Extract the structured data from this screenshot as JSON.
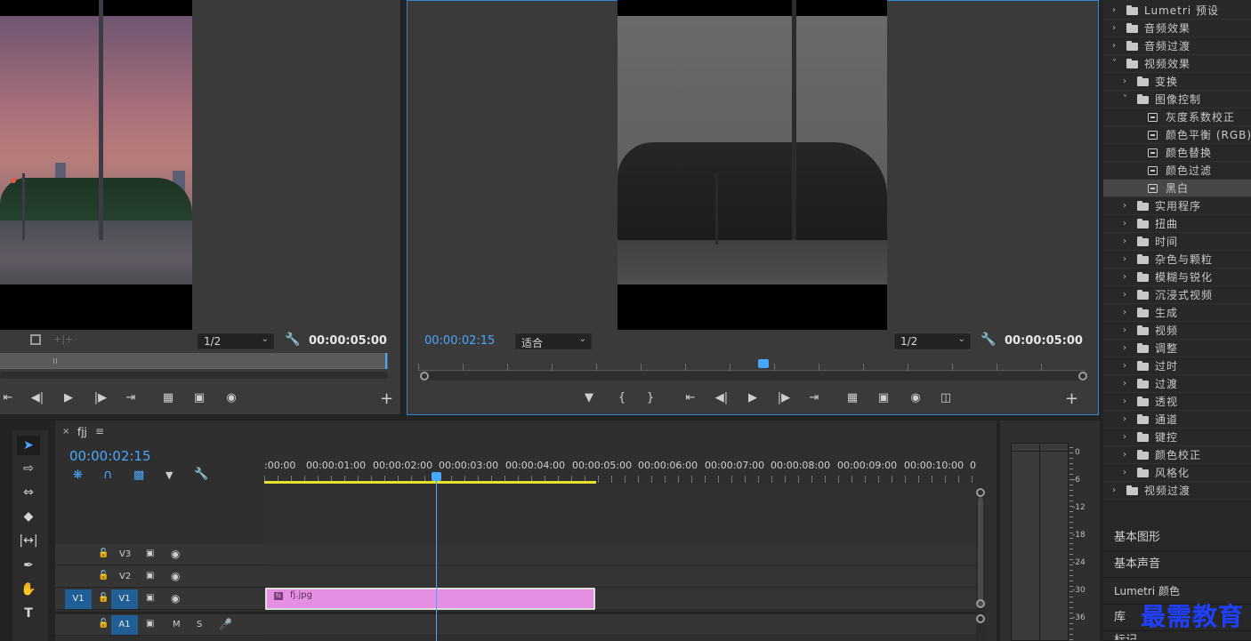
{
  "source_monitor": {
    "zoom": "1/2",
    "duration": "00:00:05:00"
  },
  "program_monitor": {
    "timecode": "00:00:02:15",
    "fit": "适合",
    "zoom": "1/2",
    "duration": "00:00:05:00"
  },
  "effects_tree": [
    {
      "label": "Lumetri 预设",
      "indent": 0,
      "kind": "folder",
      "expanded": false,
      "selected": false
    },
    {
      "label": "音频效果",
      "indent": 0,
      "kind": "folder",
      "expanded": false,
      "selected": false
    },
    {
      "label": "音频过渡",
      "indent": 0,
      "kind": "folder",
      "expanded": false,
      "selected": false
    },
    {
      "label": "视频效果",
      "indent": 0,
      "kind": "folder",
      "expanded": true,
      "selected": false
    },
    {
      "label": "变换",
      "indent": 1,
      "kind": "folder",
      "expanded": false,
      "selected": false
    },
    {
      "label": "图像控制",
      "indent": 1,
      "kind": "folder",
      "expanded": true,
      "selected": false
    },
    {
      "label": "灰度系数校正",
      "indent": 2,
      "kind": "effect",
      "expanded": false,
      "selected": false
    },
    {
      "label": "颜色平衡 (RGB)",
      "indent": 2,
      "kind": "effect",
      "expanded": false,
      "selected": false
    },
    {
      "label": "颜色替换",
      "indent": 2,
      "kind": "effect",
      "expanded": false,
      "selected": false
    },
    {
      "label": "颜色过滤",
      "indent": 2,
      "kind": "effect",
      "expanded": false,
      "selected": false
    },
    {
      "label": "黑白",
      "indent": 2,
      "kind": "effect",
      "expanded": false,
      "selected": true
    },
    {
      "label": "实用程序",
      "indent": 1,
      "kind": "folder",
      "expanded": false,
      "selected": false
    },
    {
      "label": "扭曲",
      "indent": 1,
      "kind": "folder",
      "expanded": false,
      "selected": false
    },
    {
      "label": "时间",
      "indent": 1,
      "kind": "folder",
      "expanded": false,
      "selected": false
    },
    {
      "label": "杂色与颗粒",
      "indent": 1,
      "kind": "folder",
      "expanded": false,
      "selected": false
    },
    {
      "label": "模糊与锐化",
      "indent": 1,
      "kind": "folder",
      "expanded": false,
      "selected": false
    },
    {
      "label": "沉浸式视频",
      "indent": 1,
      "kind": "folder",
      "expanded": false,
      "selected": false
    },
    {
      "label": "生成",
      "indent": 1,
      "kind": "folder",
      "expanded": false,
      "selected": false
    },
    {
      "label": "视频",
      "indent": 1,
      "kind": "folder",
      "expanded": false,
      "selected": false
    },
    {
      "label": "调整",
      "indent": 1,
      "kind": "folder",
      "expanded": false,
      "selected": false
    },
    {
      "label": "过时",
      "indent": 1,
      "kind": "folder",
      "expanded": false,
      "selected": false
    },
    {
      "label": "过渡",
      "indent": 1,
      "kind": "folder",
      "expanded": false,
      "selected": false
    },
    {
      "label": "透视",
      "indent": 1,
      "kind": "folder",
      "expanded": false,
      "selected": false
    },
    {
      "label": "通道",
      "indent": 1,
      "kind": "folder",
      "expanded": false,
      "selected": false
    },
    {
      "label": "键控",
      "indent": 1,
      "kind": "folder",
      "expanded": false,
      "selected": false
    },
    {
      "label": "颜色校正",
      "indent": 1,
      "kind": "folder",
      "expanded": false,
      "selected": false
    },
    {
      "label": "风格化",
      "indent": 1,
      "kind": "folder",
      "expanded": false,
      "selected": false
    },
    {
      "label": "视频过渡",
      "indent": 0,
      "kind": "folder",
      "expanded": false,
      "selected": false
    }
  ],
  "side_panels": [
    "基本图形",
    "基本声音",
    "Lumetri 颜色",
    "库",
    "标记"
  ],
  "timeline": {
    "sequence_name": "fjj",
    "timecode": "00:00:02:15",
    "ruler": [
      ":00:00",
      "00:00:01:00",
      "00:00:02:00",
      "00:00:03:00",
      "00:00:04:00",
      "00:00:05:00",
      "00:00:06:00",
      "00:00:07:00",
      "00:00:08:00",
      "00:00:09:00",
      "00:00:10:00",
      "0"
    ],
    "tracks": {
      "v3": "V3",
      "v2": "V2",
      "v1": "V1",
      "v1_source": "V1",
      "a1": "A1",
      "mute": "M",
      "solo": "S"
    },
    "clip": {
      "name": "fj.jpg",
      "fx": "fx"
    }
  },
  "meter_db": [
    "0",
    "-6",
    "-12",
    "-18",
    "-24",
    "-30",
    "-36"
  ],
  "watermark": "最需教育",
  "colors": {
    "accent": "#2f86d6",
    "timecode_blue": "#4aa7ff",
    "clip_pink": "#e58fe3",
    "work_area_yellow": "#e6e12a",
    "watermark_blue": "#1f41ff"
  }
}
